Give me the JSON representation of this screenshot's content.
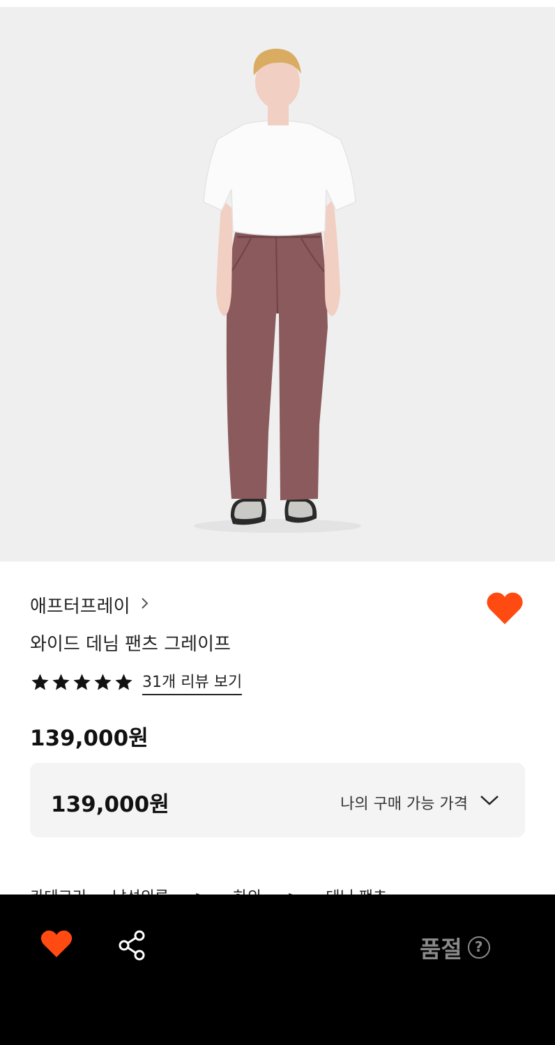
{
  "product": {
    "brand": "애프터프레이",
    "name": "와이드 데님 팬츠 그레이프",
    "rating_stars": 5,
    "review_link": "31개 리뷰 보기",
    "price": "139,000원"
  },
  "price_box": {
    "price": "139,000원",
    "label": "나의 구매 가능 가격"
  },
  "category": {
    "label": "카테고리",
    "path": [
      "남성의류",
      ">",
      "하의",
      ">",
      "데님 팬츠"
    ]
  },
  "bottom_bar": {
    "status": "품절",
    "help": "?"
  },
  "icons": {
    "brand_chevron": "chevron-right-icon",
    "wishlist": "heart-icon",
    "share": "share-icon",
    "price_toggle": "chevron-down-icon",
    "help": "question-circle-icon"
  },
  "colors": {
    "accent": "#ff4b12",
    "bottom_bar_bg": "#000000",
    "price_box_bg": "#f4f4f4",
    "soldout_text": "#8a8a8a"
  }
}
